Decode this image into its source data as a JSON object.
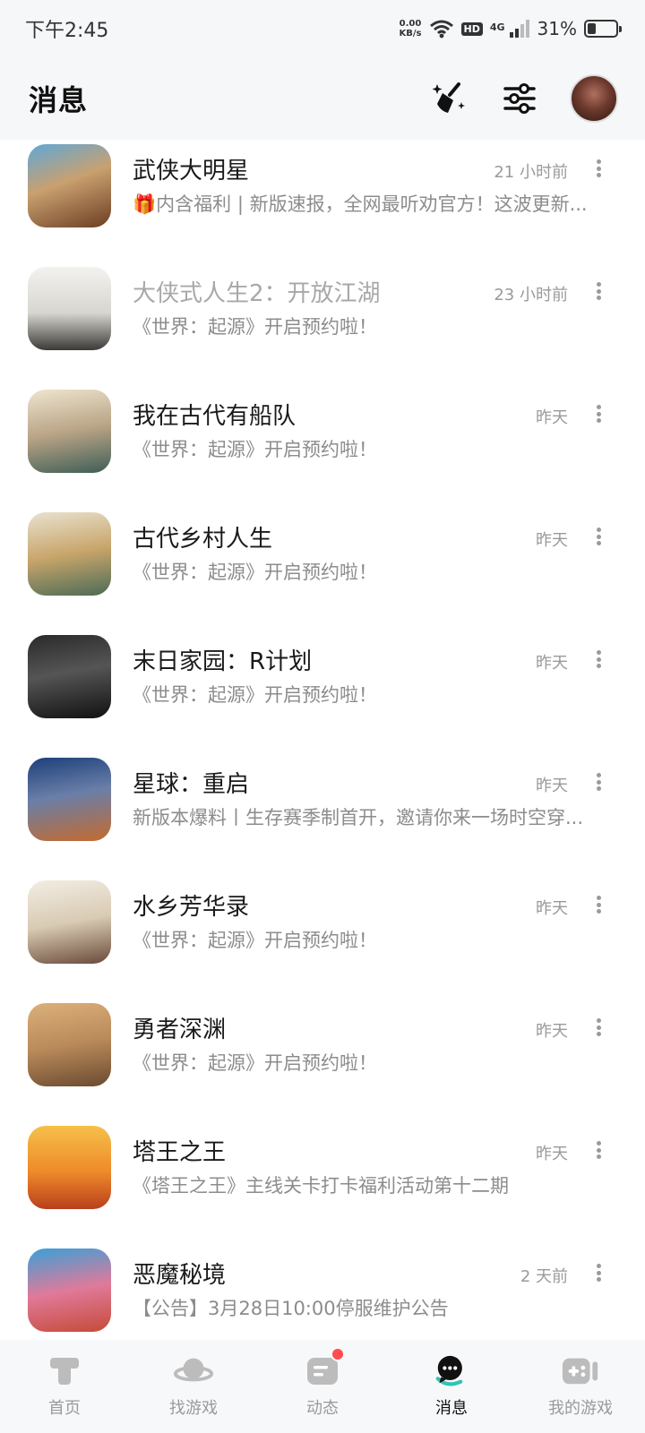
{
  "status_bar": {
    "time": "下午2:45",
    "net_speed_value": "0.00",
    "net_speed_unit": "KB/s",
    "hd": "HD",
    "network": "4G",
    "battery": "31%",
    "battery_level": 0.31
  },
  "header": {
    "title": "消息"
  },
  "messages": [
    {
      "title": "武侠大明星",
      "time": "21 小时前",
      "preview": "🎁内含福利 | 新版速报，全网最听劝官方！这波更新...",
      "read": false
    },
    {
      "title": "大侠式人生2：开放江湖",
      "time": "23 小时前",
      "preview": "《世界：起源》开启预约啦！",
      "read": true
    },
    {
      "title": "我在古代有船队",
      "time": "昨天",
      "preview": "《世界：起源》开启预约啦！",
      "read": false
    },
    {
      "title": "古代乡村人生",
      "time": "昨天",
      "preview": "《世界：起源》开启预约啦！",
      "read": false
    },
    {
      "title": "末日家园：R计划",
      "time": "昨天",
      "preview": "《世界：起源》开启预约啦！",
      "read": false
    },
    {
      "title": "星球：重启",
      "time": "昨天",
      "preview": "新版本爆料丨生存赛季制首开，邀请你来一场时空穿...",
      "read": false
    },
    {
      "title": "水乡芳华录",
      "time": "昨天",
      "preview": "《世界：起源》开启预约啦！",
      "read": false
    },
    {
      "title": "勇者深渊",
      "time": "昨天",
      "preview": "《世界：起源》开启预约啦！",
      "read": false
    },
    {
      "title": "塔王之王",
      "time": "昨天",
      "preview": "《塔王之王》主线关卡打卡福利活动第十二期",
      "read": false
    },
    {
      "title": "恶魔秘境",
      "time": "2 天前",
      "preview": "【公告】3月28日10:00停服维护公告",
      "read": false
    }
  ],
  "tabs": [
    {
      "label": "首页",
      "icon": "home-icon",
      "active": false
    },
    {
      "label": "找游戏",
      "icon": "planet-icon",
      "active": false
    },
    {
      "label": "动态",
      "icon": "feed-icon",
      "active": false,
      "badge": true
    },
    {
      "label": "消息",
      "icon": "message-icon",
      "active": true
    },
    {
      "label": "我的游戏",
      "icon": "gamepad-icon",
      "active": false
    }
  ],
  "colors": {
    "accent": "#2ec4b6",
    "badge": "#ff4d4f",
    "muted_text": "#9a9a9a"
  }
}
